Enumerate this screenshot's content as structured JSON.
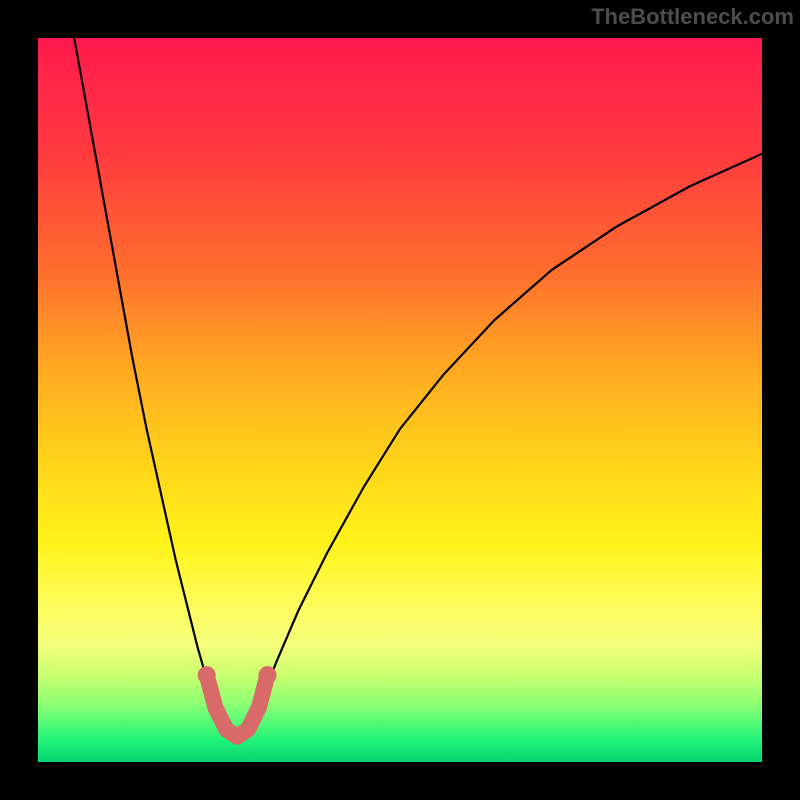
{
  "watermark": "TheBottleneck.com",
  "colors": {
    "frame": "#000000",
    "curve": "#000000",
    "highlight": "#d86a6a",
    "gradient_top": "#ff1a4d",
    "gradient_bottom": "#06d36e"
  },
  "chart_data": {
    "type": "line",
    "title": "",
    "xlabel": "",
    "ylabel": "",
    "xlim": [
      0,
      100
    ],
    "ylim": [
      0,
      100
    ],
    "note": "x and y are percentages of plot-area width/height; y=0 is top, y=100 is bottom",
    "series": [
      {
        "name": "curve_left",
        "x": [
          5,
          7,
          9,
          11,
          13,
          15,
          17,
          19,
          20,
          21,
          22,
          23,
          24,
          25
        ],
        "y": [
          0,
          11,
          22,
          33,
          44,
          54,
          63,
          72,
          76,
          80,
          84,
          87.5,
          90.5,
          93.5
        ]
      },
      {
        "name": "curve_right",
        "x": [
          30,
          31,
          33,
          36,
          40,
          45,
          50,
          56,
          63,
          71,
          80,
          90,
          100
        ],
        "y": [
          93.5,
          91,
          86,
          79,
          71,
          62,
          54,
          46.5,
          39,
          32,
          26,
          20.5,
          16
        ]
      },
      {
        "name": "bottom_bridge",
        "x": [
          25,
          26,
          27,
          28,
          29,
          30
        ],
        "y": [
          93.5,
          95.5,
          96.5,
          96.5,
          95.5,
          93.5
        ]
      }
    ],
    "highlight": {
      "name": "optimal_zone",
      "x": [
        23.3,
        24.5,
        26,
        27.5,
        29,
        30.5,
        31.7
      ],
      "y": [
        88,
        92.5,
        95.5,
        96.5,
        95.5,
        92.5,
        88
      ]
    }
  }
}
